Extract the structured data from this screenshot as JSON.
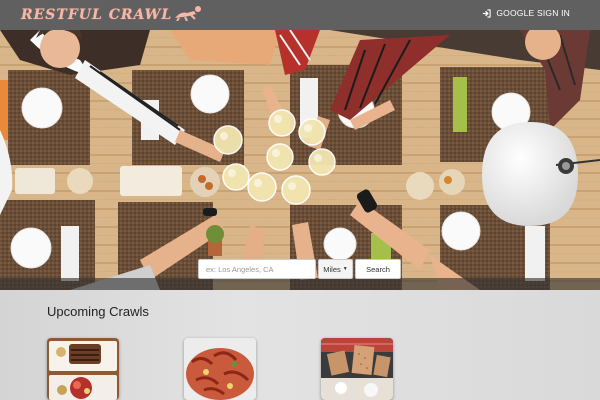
{
  "brand": {
    "name": "Restful Crawl"
  },
  "nav": {
    "signin_label": "GOOGLE SIGN IN"
  },
  "search": {
    "placeholder": "ex: Los Angeles, CA",
    "unit_selected": "Miles",
    "button_label": "Search"
  },
  "upcoming": {
    "title": "Upcoming Crawls",
    "cards": [
      {
        "image": "food-plates-photo"
      },
      {
        "image": "crawfish-photo"
      },
      {
        "image": "dessert-crackers-photo"
      }
    ]
  },
  "colors": {
    "brand": "#f6b8a6",
    "navbar": "#555555",
    "table_wood": "#d7b487"
  }
}
